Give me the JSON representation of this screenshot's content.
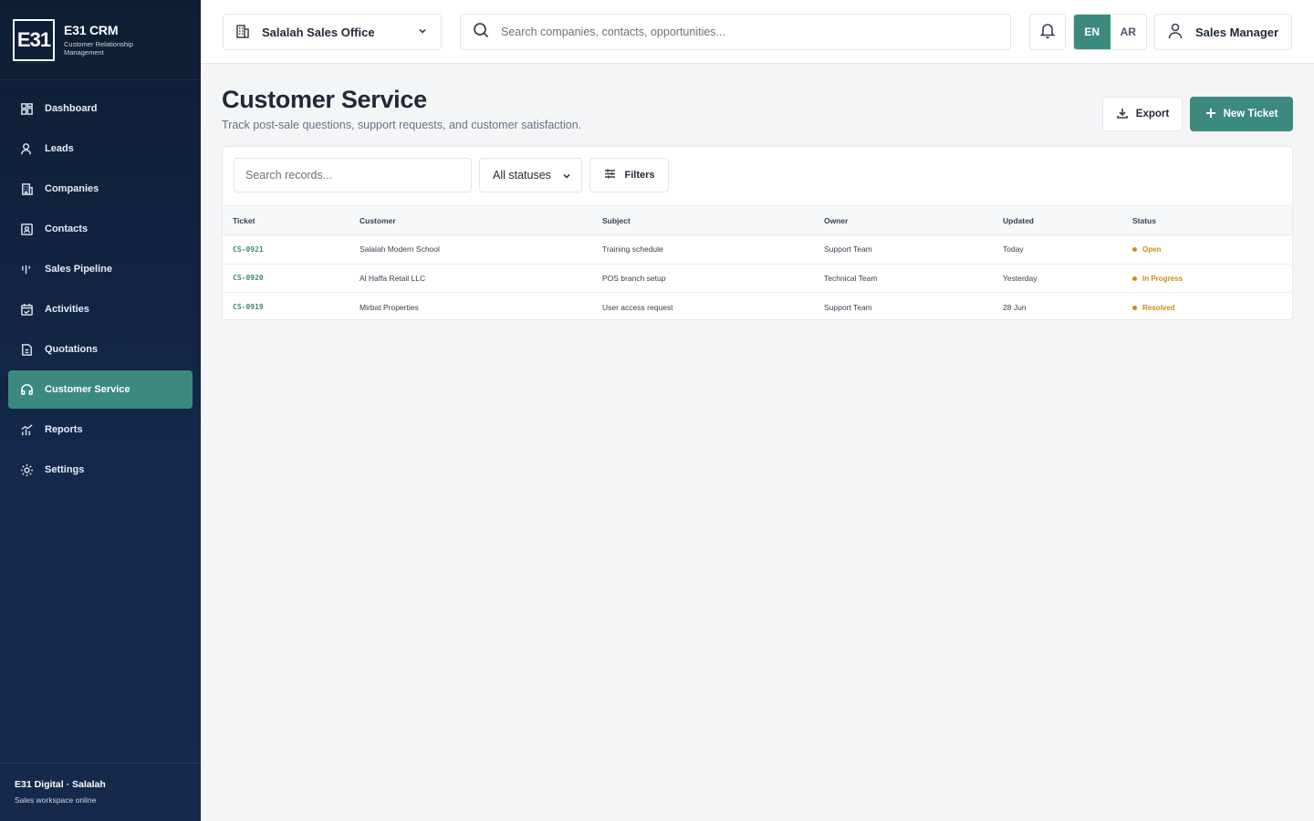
{
  "brand": {
    "logo": "E31",
    "title": "E31 CRM",
    "subtitle": "Customer Relationship Management"
  },
  "nav": [
    {
      "label": "Dashboard",
      "icon": "grid-icon"
    },
    {
      "label": "Leads",
      "icon": "user-icon"
    },
    {
      "label": "Companies",
      "icon": "building-icon"
    },
    {
      "label": "Contacts",
      "icon": "contact-card-icon"
    },
    {
      "label": "Sales Pipeline",
      "icon": "pipeline-icon"
    },
    {
      "label": "Activities",
      "icon": "calendar-icon"
    },
    {
      "label": "Quotations",
      "icon": "document-icon"
    },
    {
      "label": "Customer Service",
      "icon": "headset-icon",
      "active": true
    },
    {
      "label": "Reports",
      "icon": "chart-icon"
    },
    {
      "label": "Settings",
      "icon": "gear-icon"
    }
  ],
  "footer": {
    "org": "E31 Digital · Salalah",
    "status": "Sales workspace online"
  },
  "topbar": {
    "office": "Salalah Sales Office",
    "search_placeholder": "Search companies, contacts, opportunities...",
    "lang_en": "EN",
    "lang_ar": "AR",
    "user": "Sales Manager"
  },
  "page": {
    "title": "Customer Service",
    "subtitle": "Track post-sale questions, support requests, and customer satisfaction.",
    "export_label": "Export",
    "new_label": "New Ticket"
  },
  "toolbar": {
    "search_placeholder": "Search records...",
    "status_filter": "All statuses",
    "filters_label": "Filters"
  },
  "table": {
    "headers": [
      "Ticket",
      "Customer",
      "Subject",
      "Owner",
      "Updated",
      "Status"
    ],
    "rows": [
      {
        "ticket": "CS-0921",
        "customer": "Salalah Modern School",
        "subject": "Training schedule",
        "owner": "Support Team",
        "updated": "Today",
        "status": "Open"
      },
      {
        "ticket": "CS-0920",
        "customer": "Al Haffa Retail LLC",
        "subject": "POS branch setup",
        "owner": "Technical Team",
        "updated": "Yesterday",
        "status": "In Progress"
      },
      {
        "ticket": "CS-0919",
        "customer": "Mirbat Properties",
        "subject": "User access request",
        "owner": "Support Team",
        "updated": "28 Jun",
        "status": "Resolved"
      }
    ]
  },
  "colors": {
    "accent": "#3c8a7e",
    "sidebar": "#13284a",
    "status": "#d08a17"
  }
}
